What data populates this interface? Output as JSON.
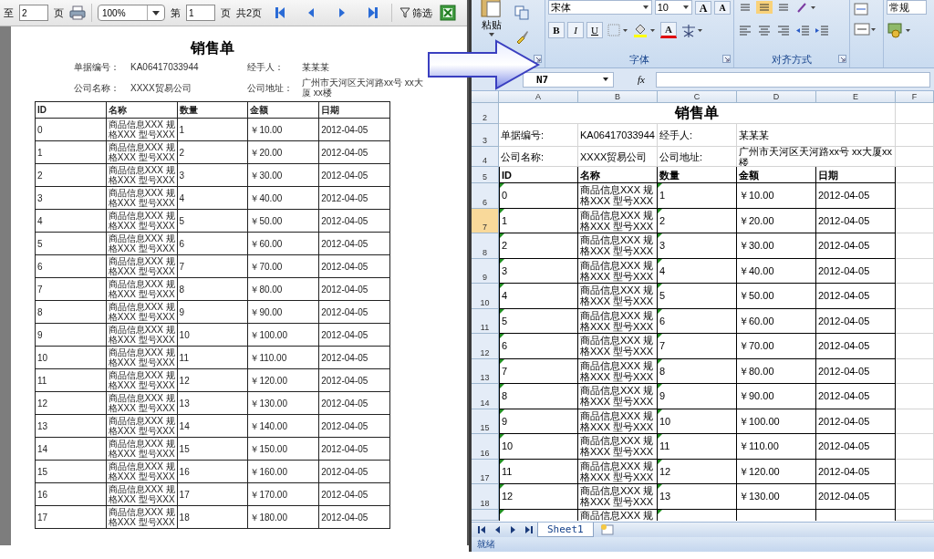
{
  "viewer": {
    "toolbar": {
      "to_label": "至",
      "to_value": "2",
      "to_suffix": "页",
      "zoom": "100%",
      "page_label": "第",
      "page_value": "1",
      "page_suffix": "页",
      "page_count": "共2页",
      "filter_button": "筛选"
    },
    "report": {
      "title": "销售单",
      "field_rows": [
        {
          "items": [
            {
              "label": "单据编号：",
              "value": "KA06417033944"
            },
            {
              "label": "经手人：",
              "value": "某某某"
            }
          ]
        },
        {
          "items": [
            {
              "label": "公司名称：",
              "value": "XXXX贸易公司"
            },
            {
              "label": "公司地址：",
              "value": "广州市天河区天河路xx号 xx大厦 xx楼"
            }
          ]
        }
      ],
      "columns": [
        "ID",
        "名称",
        "数量",
        "金额",
        "日期"
      ],
      "rows": [
        [
          "0",
          "商品信息XXX 规格XXX 型号XXX",
          "1",
          "￥10.00",
          "2012-04-05"
        ],
        [
          "1",
          "商品信息XXX 规格XXX 型号XXX",
          "2",
          "￥20.00",
          "2012-04-05"
        ],
        [
          "2",
          "商品信息XXX 规格XXX 型号XXX",
          "3",
          "￥30.00",
          "2012-04-05"
        ],
        [
          "3",
          "商品信息XXX 规格XXX 型号XXX",
          "4",
          "￥40.00",
          "2012-04-05"
        ],
        [
          "4",
          "商品信息XXX 规格XXX 型号XXX",
          "5",
          "￥50.00",
          "2012-04-05"
        ],
        [
          "5",
          "商品信息XXX 规格XXX 型号XXX",
          "6",
          "￥60.00",
          "2012-04-05"
        ],
        [
          "6",
          "商品信息XXX 规格XXX 型号XXX",
          "7",
          "￥70.00",
          "2012-04-05"
        ],
        [
          "7",
          "商品信息XXX 规格XXX 型号XXX",
          "8",
          "￥80.00",
          "2012-04-05"
        ],
        [
          "8",
          "商品信息XXX 规格XXX 型号XXX",
          "9",
          "￥90.00",
          "2012-04-05"
        ],
        [
          "9",
          "商品信息XXX 规格XXX 型号XXX",
          "10",
          "￥100.00",
          "2012-04-05"
        ],
        [
          "10",
          "商品信息XXX 规格XXX 型号XXX",
          "11",
          "￥110.00",
          "2012-04-05"
        ],
        [
          "11",
          "商品信息XXX 规格XXX 型号XXX",
          "12",
          "￥120.00",
          "2012-04-05"
        ],
        [
          "12",
          "商品信息XXX 规格XXX 型号XXX",
          "13",
          "￥130.00",
          "2012-04-05"
        ],
        [
          "13",
          "商品信息XXX 规格XXX 型号XXX",
          "14",
          "￥140.00",
          "2012-04-05"
        ],
        [
          "14",
          "商品信息XXX 规格XXX 型号XXX",
          "15",
          "￥150.00",
          "2012-04-05"
        ],
        [
          "15",
          "商品信息XXX 规格XXX 型号XXX",
          "16",
          "￥160.00",
          "2012-04-05"
        ],
        [
          "16",
          "商品信息XXX 规格XXX 型号XXX",
          "17",
          "￥170.00",
          "2012-04-05"
        ],
        [
          "17",
          "商品信息XXX 规格XXX 型号XXX",
          "18",
          "￥180.00",
          "2012-04-05"
        ]
      ]
    }
  },
  "excel": {
    "ribbon": {
      "paste_label": "粘贴",
      "font_name": "宋体",
      "font_size": "10",
      "grow_font": "A",
      "shrink_font": "A",
      "bold": "B",
      "italic": "I",
      "underline": "U",
      "font_color": "A",
      "font_group": "字体",
      "alignment_group": "对齐方式",
      "number_format": "常规"
    },
    "name_box": "N7",
    "function_label": "fx",
    "columns": [
      "A",
      "B",
      "C",
      "D",
      "E",
      "F"
    ],
    "rows": [
      {
        "number": "2",
        "kind": "title",
        "selected": false,
        "cells": [
          "销售单"
        ]
      },
      {
        "number": "3",
        "kind": "info",
        "selected": false,
        "cells": [
          "单据编号:",
          "KA06417033944",
          "经手人:",
          "某某某"
        ]
      },
      {
        "number": "4",
        "kind": "info",
        "selected": false,
        "cells": [
          "公司名称:",
          "XXXX贸易公司",
          "公司地址:",
          "广州市天河区天河路xx号 xx大厦xx楼"
        ]
      },
      {
        "number": "5",
        "kind": "header",
        "selected": false,
        "cells": [
          "ID",
          "名称",
          "数量",
          "金额",
          "日期"
        ]
      },
      {
        "number": "6",
        "kind": "data",
        "selected": false,
        "cells": [
          "0",
          "商品信息XXX 规格XXX 型号XXX",
          "1",
          "￥10.00",
          "2012-04-05"
        ]
      },
      {
        "number": "7",
        "kind": "data",
        "selected": true,
        "cells": [
          "1",
          "商品信息XXX 规格XXX 型号XXX",
          "2",
          "￥20.00",
          "2012-04-05"
        ]
      },
      {
        "number": "8",
        "kind": "data",
        "selected": false,
        "cells": [
          "2",
          "商品信息XXX 规格XXX 型号XXX",
          "3",
          "￥30.00",
          "2012-04-05"
        ]
      },
      {
        "number": "9",
        "kind": "data",
        "selected": false,
        "cells": [
          "3",
          "商品信息XXX 规格XXX 型号XXX",
          "4",
          "￥40.00",
          "2012-04-05"
        ]
      },
      {
        "number": "10",
        "kind": "data",
        "selected": false,
        "cells": [
          "4",
          "商品信息XXX 规格XXX 型号XXX",
          "5",
          "￥50.00",
          "2012-04-05"
        ]
      },
      {
        "number": "11",
        "kind": "data",
        "selected": false,
        "cells": [
          "5",
          "商品信息XXX 规格XXX 型号XXX",
          "6",
          "￥60.00",
          "2012-04-05"
        ]
      },
      {
        "number": "12",
        "kind": "data",
        "selected": false,
        "cells": [
          "6",
          "商品信息XXX 规格XXX 型号XXX",
          "7",
          "￥70.00",
          "2012-04-05"
        ]
      },
      {
        "number": "13",
        "kind": "data",
        "selected": false,
        "cells": [
          "7",
          "商品信息XXX 规格XXX 型号XXX",
          "8",
          "￥80.00",
          "2012-04-05"
        ]
      },
      {
        "number": "14",
        "kind": "data",
        "selected": false,
        "cells": [
          "8",
          "商品信息XXX 规格XXX 型号XXX",
          "9",
          "￥90.00",
          "2012-04-05"
        ]
      },
      {
        "number": "15",
        "kind": "data",
        "selected": false,
        "cells": [
          "9",
          "商品信息XXX 规格XXX 型号XXX",
          "10",
          "￥100.00",
          "2012-04-05"
        ]
      },
      {
        "number": "16",
        "kind": "data",
        "selected": false,
        "cells": [
          "10",
          "商品信息XXX 规格XXX 型号XXX",
          "11",
          "￥110.00",
          "2012-04-05"
        ]
      },
      {
        "number": "17",
        "kind": "data",
        "selected": false,
        "cells": [
          "11",
          "商品信息XXX 规格XXX 型号XXX",
          "12",
          "￥120.00",
          "2012-04-05"
        ]
      },
      {
        "number": "18",
        "kind": "data",
        "selected": false,
        "cells": [
          "12",
          "商品信息XXX 规格XXX 型号XXX",
          "13",
          "￥130.00",
          "2012-04-05"
        ]
      },
      {
        "kind": "partial",
        "selected": false,
        "cells": [
          "",
          "商品信息XXX 规"
        ]
      }
    ],
    "sheet_tabs": [
      {
        "label": "Sheet1",
        "selected": true
      }
    ],
    "status": "就绪"
  }
}
